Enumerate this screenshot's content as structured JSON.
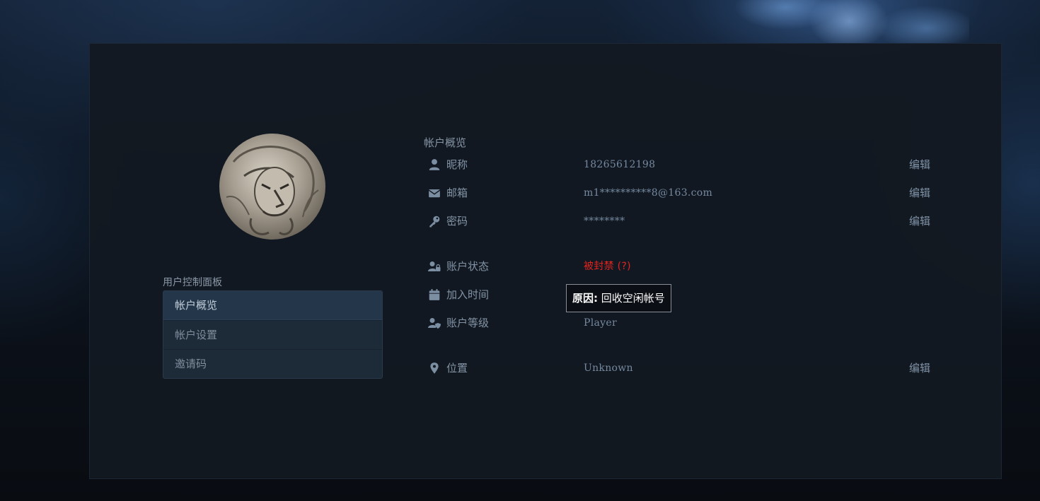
{
  "control_panel": {
    "title": "用户控制面板",
    "menu": [
      {
        "label": "帐户概览",
        "active": true
      },
      {
        "label": "帐户设置",
        "active": false
      },
      {
        "label": "邀请码",
        "active": false
      }
    ]
  },
  "overview": {
    "title": "帐户概览",
    "rows": [
      {
        "icon": "user-icon",
        "label": "昵称",
        "value": "18265612198",
        "edit": "编辑"
      },
      {
        "icon": "envelope-icon",
        "label": "邮箱",
        "value": "m1**********8@163.com",
        "edit": "编辑"
      },
      {
        "icon": "key-icon",
        "label": "密码",
        "value": "********",
        "edit": "编辑"
      },
      {
        "icon": "user-lock-icon",
        "label": "账户状态",
        "value": "被封禁 (?)"
      },
      {
        "icon": "calendar-icon",
        "label": "加入时间",
        "value": ""
      },
      {
        "icon": "user-shield-icon",
        "label": "账户等级",
        "value": "Player"
      },
      {
        "icon": "map-marker-icon",
        "label": "位置",
        "value": "Unknown",
        "edit": "编辑"
      }
    ]
  },
  "tooltip": {
    "key": "原因:",
    "text": " 回收空闲帐号"
  },
  "colors": {
    "banned": "#e0251f",
    "panel": "#131921",
    "menu_active": "#24364a"
  }
}
